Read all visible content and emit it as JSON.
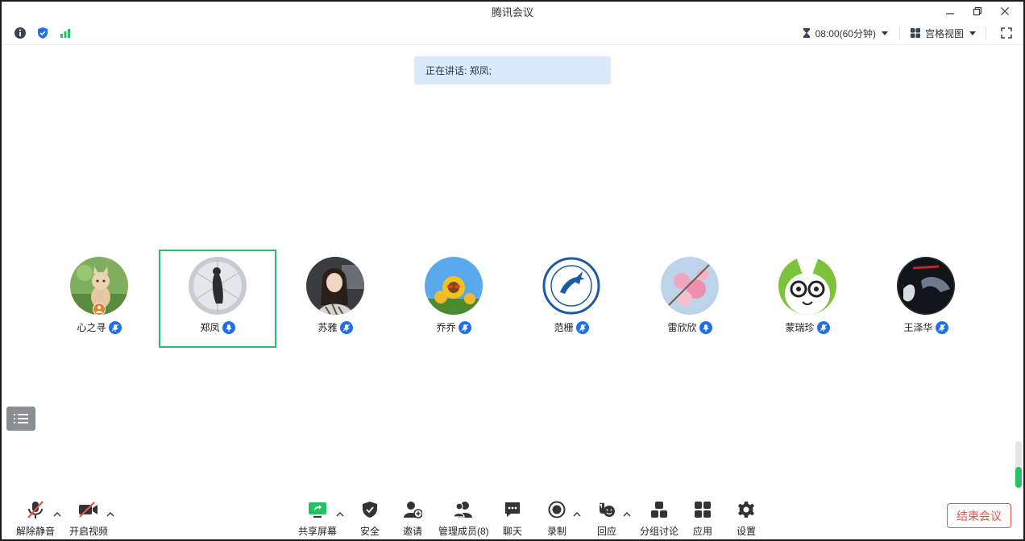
{
  "window": {
    "title": "腾讯会议"
  },
  "infobar": {
    "timer": "08:00(60分钟)",
    "layout": "宫格视图"
  },
  "speaking": {
    "text": "正在讲话: 郑凤;"
  },
  "participants": [
    {
      "name": "心之寻",
      "is_host": true
    },
    {
      "name": "郑凤",
      "active": true
    },
    {
      "name": "苏雅"
    },
    {
      "name": "乔乔"
    },
    {
      "name": "范栅"
    },
    {
      "name": "雷欣欣"
    },
    {
      "name": "蒙瑞珍"
    },
    {
      "name": "王泽华"
    }
  ],
  "toolbar": {
    "unmute": "解除静音",
    "start_video": "开启视频",
    "share_screen": "共享屏幕",
    "security": "安全",
    "invite": "邀请",
    "members": "管理成员(8)",
    "chat": "聊天",
    "record": "录制",
    "react": "回应",
    "breakout": "分组讨论",
    "apps": "应用",
    "settings": "设置",
    "end_meeting": "结束会议"
  },
  "audio_level": 0.45,
  "colors": {
    "accent": "#1f6fe8",
    "active_border": "#23c163",
    "end_button": "#e8544a",
    "speaking_bg": "#dce9fa"
  }
}
